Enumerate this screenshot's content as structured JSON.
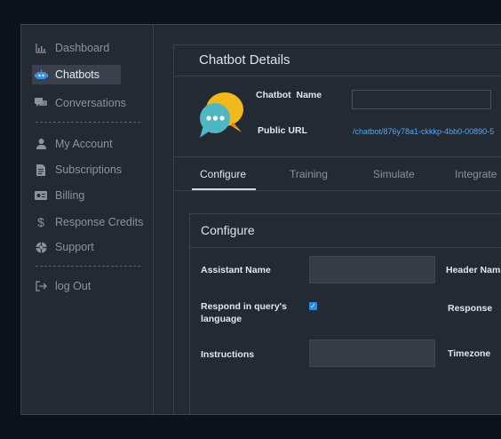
{
  "sidebar": {
    "items": [
      {
        "label": "Dashboard",
        "icon": "bar-chart-icon"
      },
      {
        "label": "Chatbots",
        "icon": "robot-icon"
      },
      {
        "label": "Conversations",
        "icon": "chat-bubbles-icon"
      },
      {
        "label": "My Account",
        "icon": "user-icon"
      },
      {
        "label": "Subscriptions",
        "icon": "document-icon"
      },
      {
        "label": "Billing",
        "icon": "credit-card-icon"
      },
      {
        "label": "Response Credits",
        "icon": "dollar-icon"
      },
      {
        "label": "Support",
        "icon": "support-icon"
      },
      {
        "label": "log Out",
        "icon": "logout-icon"
      }
    ],
    "active": "Chatbots"
  },
  "details": {
    "title": "Chatbot Details",
    "name_label": "Chatbot  Name",
    "name_value": "",
    "url_label": "Public URL",
    "url_value": "/chatbot/876y78a1-ckkkp-4bb0-00890-5"
  },
  "tabs": [
    {
      "label": "Configure",
      "active": true
    },
    {
      "label": "Training",
      "active": false
    },
    {
      "label": "Simulate",
      "active": false
    },
    {
      "label": "Integrate",
      "active": false
    }
  ],
  "configure": {
    "title": "Configure",
    "assistant_name_label": "Assistant Name",
    "assistant_name_value": "",
    "header_name_label": "Header Nam",
    "respond_label_line1": "Respond in query's",
    "respond_label_line2": "language",
    "respond_checked": true,
    "response_label": "Response",
    "instructions_label": "Instructions",
    "instructions_value": "",
    "timezone_label": "Timezone"
  },
  "colors": {
    "accent": "#2b8be0",
    "link": "#5aa7e6",
    "background": "#0e121a",
    "panel": "#242a33"
  }
}
